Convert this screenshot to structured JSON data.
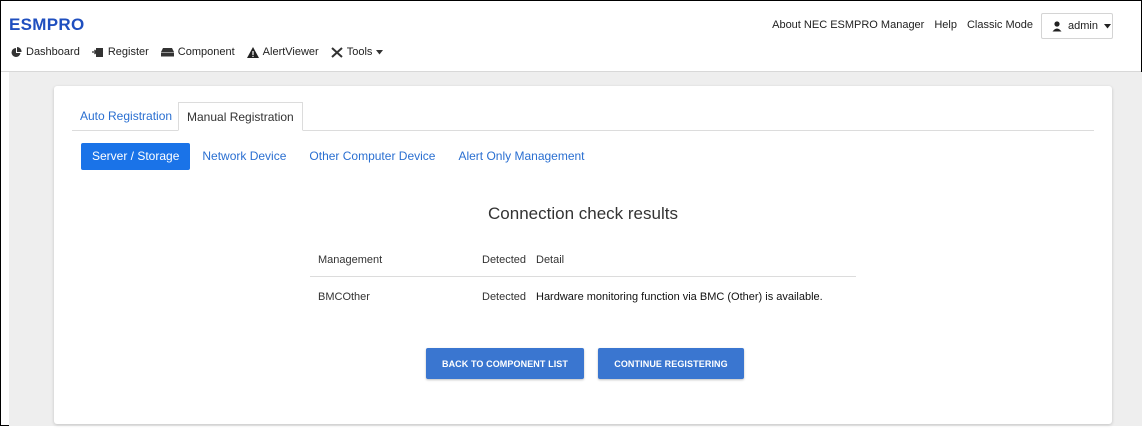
{
  "header": {
    "brand": "ESMPRO",
    "links": [
      "About NEC ESMPRO Manager",
      "Help",
      "Classic Mode"
    ],
    "user": "admin"
  },
  "nav": {
    "items": [
      {
        "label": "Dashboard",
        "icon": "pie-chart-icon"
      },
      {
        "label": "Register",
        "icon": "register-icon"
      },
      {
        "label": "Component",
        "icon": "server-icon"
      },
      {
        "label": "AlertViewer",
        "icon": "alert-icon"
      },
      {
        "label": "Tools",
        "icon": "tools-icon"
      }
    ]
  },
  "tabs": {
    "auto": "Auto Registration",
    "manual": "Manual Registration"
  },
  "subtabs": [
    "Server / Storage",
    "Network Device",
    "Other Computer Device",
    "Alert Only Management"
  ],
  "results": {
    "title": "Connection check results",
    "columns": [
      "Management",
      "Detected",
      "Detail"
    ],
    "rows": [
      {
        "management": "BMCOther",
        "detected": "Detected",
        "detail": "Hardware monitoring function via BMC (Other) is available."
      }
    ]
  },
  "buttons": {
    "back": "BACK TO COMPONENT LIST",
    "continue": "CONTINUE REGISTERING"
  },
  "colors": {
    "accent": "#1a73e8",
    "button": "#3a76d0",
    "brand": "#1f4fbf"
  }
}
